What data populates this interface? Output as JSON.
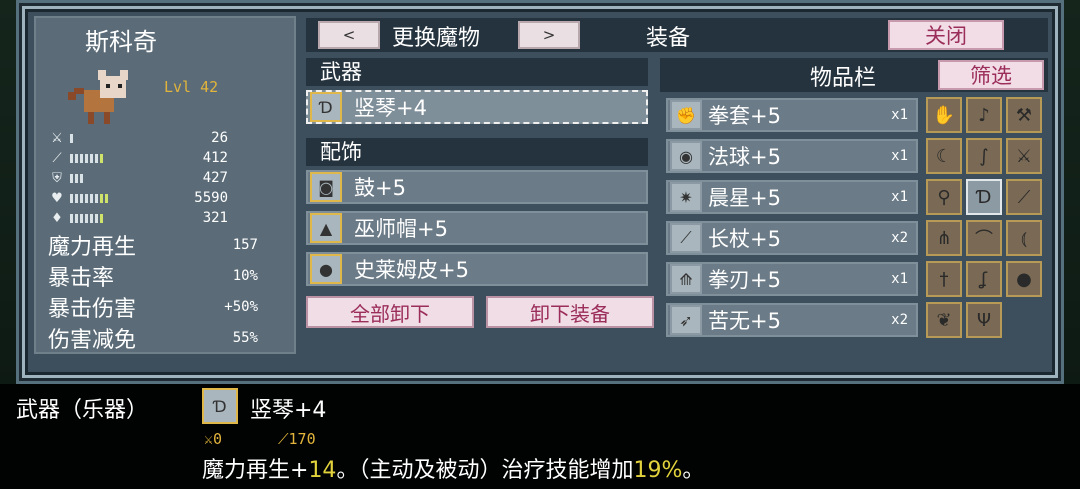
{
  "monster": {
    "name": "斯科奇",
    "level": "Lvl 42"
  },
  "stats": [
    {
      "icon": "sword-icon",
      "value": "26",
      "bars": 1,
      "green": 0
    },
    {
      "icon": "staff-icon",
      "value": "412",
      "bars": 7,
      "green": 1
    },
    {
      "icon": "shield-icon",
      "value": "427",
      "bars": 3,
      "green": 0
    },
    {
      "icon": "heart-icon",
      "value": "5590",
      "bars": 8,
      "green": 2
    },
    {
      "icon": "mana-icon",
      "value": "321",
      "bars": 7,
      "green": 1
    }
  ],
  "extra_stats": [
    {
      "label": "魔力再生",
      "value": "157"
    },
    {
      "label": "暴击率",
      "value": "10%"
    },
    {
      "label": "暴击伤害",
      "value": "+50%"
    },
    {
      "label": "伤害减免",
      "value": "55%"
    }
  ],
  "header": {
    "prev": "<",
    "swap_label": "更换魔物",
    "next": ">",
    "equip_title": "装备",
    "close": "关闭"
  },
  "equipment": {
    "weapon_header": "武器",
    "weapon": {
      "name": "竖琴+4",
      "icon": "harp-icon"
    },
    "accessory_header": "配饰",
    "accessories": [
      {
        "name": "鼓+5",
        "icon": "drum-icon"
      },
      {
        "name": "巫师帽+5",
        "icon": "wizard-hat-icon"
      },
      {
        "name": "史莱姆皮+5",
        "icon": "slime-hide-icon"
      }
    ],
    "unequip_all": "全部卸下",
    "unequip": "卸下装备"
  },
  "inventory": {
    "title": "物品栏",
    "filter": "筛选",
    "items": [
      {
        "name": "拳套+5",
        "count": "x1",
        "icon": "gauntlet-icon"
      },
      {
        "name": "法球+5",
        "count": "x1",
        "icon": "orb-icon"
      },
      {
        "name": "晨星+5",
        "count": "x1",
        "icon": "morning-star-icon"
      },
      {
        "name": "长杖+5",
        "count": "x2",
        "icon": "staff-icon"
      },
      {
        "name": "拳刃+5",
        "count": "x1",
        "icon": "katar-icon"
      },
      {
        "name": "苦无+5",
        "count": "x2",
        "icon": "kunai-icon"
      }
    ],
    "grid": [
      "claw-icon",
      "lute-icon",
      "hammer-icon",
      "scythe-icon",
      "whip-icon",
      "sword-icon",
      "wand-icon",
      "harp-icon",
      "staff-icon",
      "rake-icon",
      "boomerang-icon",
      "bow-icon",
      "dagger-icon",
      "hook-icon",
      "bomb-icon",
      "feather-icon",
      "trident-icon"
    ]
  },
  "description": {
    "category": "武器（乐器）",
    "item_name": "竖琴+4",
    "stat_attack": "0",
    "stat_magic": "170",
    "effect_prefix": "魔力再生+",
    "effect_regen": "14",
    "effect_middle": "。（主动及被动）治疗技能增加",
    "effect_heal": "19%",
    "effect_suffix": "。"
  },
  "colors": {
    "accent_gold": "#e2b43c",
    "button_pink": "#9b2d5a",
    "panel": "#5b6c78"
  }
}
